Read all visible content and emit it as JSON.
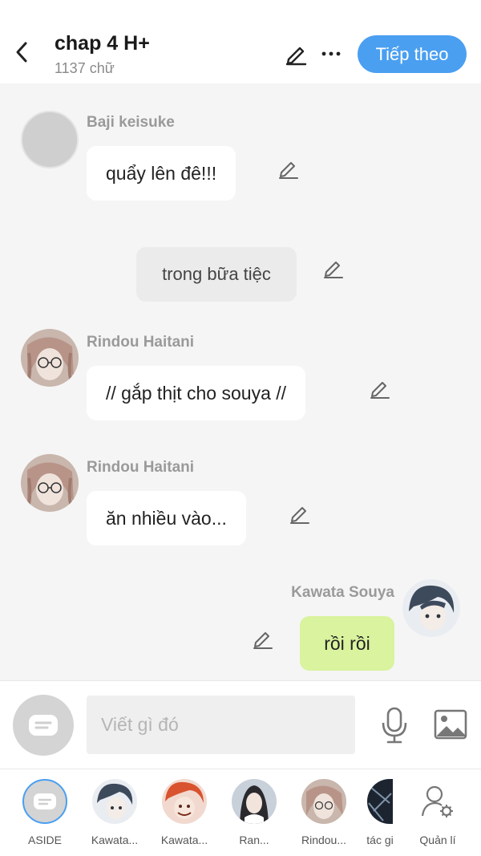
{
  "header": {
    "title": "chap 4 H+",
    "word_count": "1137 chữ",
    "next_label": "Tiếp theo"
  },
  "messages": [
    {
      "type": "character",
      "sender": "Baji keisuke",
      "text": "quẩy lên đê!!!"
    },
    {
      "type": "narration",
      "text": "trong bữa tiệc"
    },
    {
      "type": "character",
      "sender": "Rindou Haitani",
      "text": "// gắp thịt cho souya //"
    },
    {
      "type": "character",
      "sender": "Rindou Haitani",
      "text": "ăn nhiều vào..."
    },
    {
      "type": "self",
      "sender": "Kawata Souya",
      "text": "rồi rồi"
    }
  ],
  "composer": {
    "placeholder": "Viết gì đó"
  },
  "characters": [
    {
      "label": "ASIDE"
    },
    {
      "label": "Kawata..."
    },
    {
      "label": "Kawata..."
    },
    {
      "label": "Ran..."
    },
    {
      "label": "Rindou..."
    },
    {
      "label": "tác gi"
    },
    {
      "label": "Quản lí"
    }
  ],
  "colors": {
    "accent": "#4a9ff1",
    "self_bubble": "#d9f39e",
    "background": "#f5f5f5"
  },
  "icons": [
    "chevron-left-icon",
    "pencil-icon",
    "more-icon",
    "chat-bubble-icon",
    "mic-icon",
    "image-icon",
    "user-settings-icon"
  ]
}
